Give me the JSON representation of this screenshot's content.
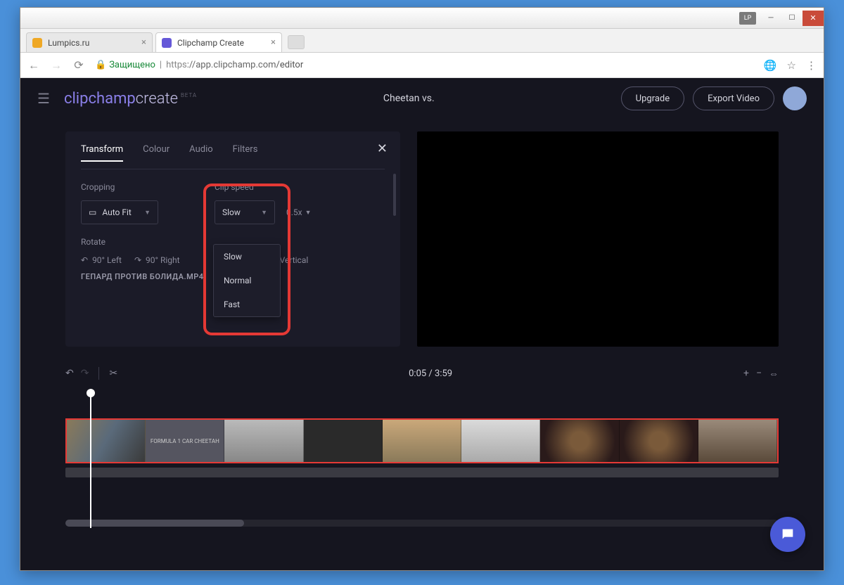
{
  "window": {
    "badge": "LP"
  },
  "tabs": [
    {
      "label": "Lumpics.ru",
      "active": false
    },
    {
      "label": "Clipchamp Create",
      "active": true
    }
  ],
  "addressbar": {
    "secure_label": "Защищено",
    "scheme": "https",
    "host": "://app.clipchamp.com",
    "path": "/editor"
  },
  "app_header": {
    "brand_a": "clipchamp",
    "brand_b": "create",
    "beta": "BETA",
    "project_title": "Cheetan vs.",
    "upgrade": "Upgrade",
    "export": "Export Video"
  },
  "panel": {
    "tabs": {
      "transform": "Transform",
      "colour": "Colour",
      "audio": "Audio",
      "filters": "Filters"
    },
    "cropping_label": "Cropping",
    "cropping_value": "Auto Fit",
    "speed_label": "Clip speed",
    "speed_value": "Slow",
    "speed_mult": "0.5x",
    "rotate_label": "Rotate",
    "rotate_left": "90° Left",
    "rotate_right": "90° Right",
    "flip_vertical": "Vertical",
    "filename": "ГЕПАРД ПРОТИВ БОЛИДА.MP4",
    "speed_options": {
      "slow": "Slow",
      "normal": "Normal",
      "fast": "Fast"
    }
  },
  "timeline": {
    "cur": "0:05",
    "sep": " / ",
    "dur": "3:59",
    "thumb2": "FORMULA 1 CAR\nCHEETAH"
  }
}
